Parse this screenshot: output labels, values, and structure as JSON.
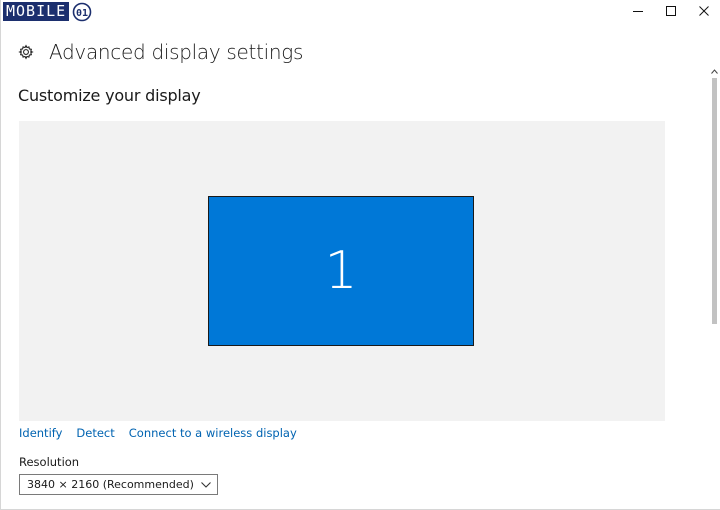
{
  "watermark": {
    "text_main": "MOBILE",
    "text_badge": "01"
  },
  "window": {
    "caption": {
      "minimize_icon": "minimize-icon",
      "maximize_icon": "maximize-icon",
      "close_icon": "close-icon"
    }
  },
  "header": {
    "icon": "gear-icon",
    "title": "Advanced display settings"
  },
  "section": {
    "title": "Customize your display"
  },
  "preview": {
    "monitor_label": "1",
    "monitor_color": "#0078d7",
    "background_color": "#f2f2f2"
  },
  "links": {
    "identify": "Identify",
    "detect": "Detect",
    "wireless": "Connect to a wireless display"
  },
  "resolution": {
    "label": "Resolution",
    "selected": "3840 × 2160 (Recommended)"
  },
  "colors": {
    "accent": "#0078d7",
    "link": "#0063b1"
  }
}
